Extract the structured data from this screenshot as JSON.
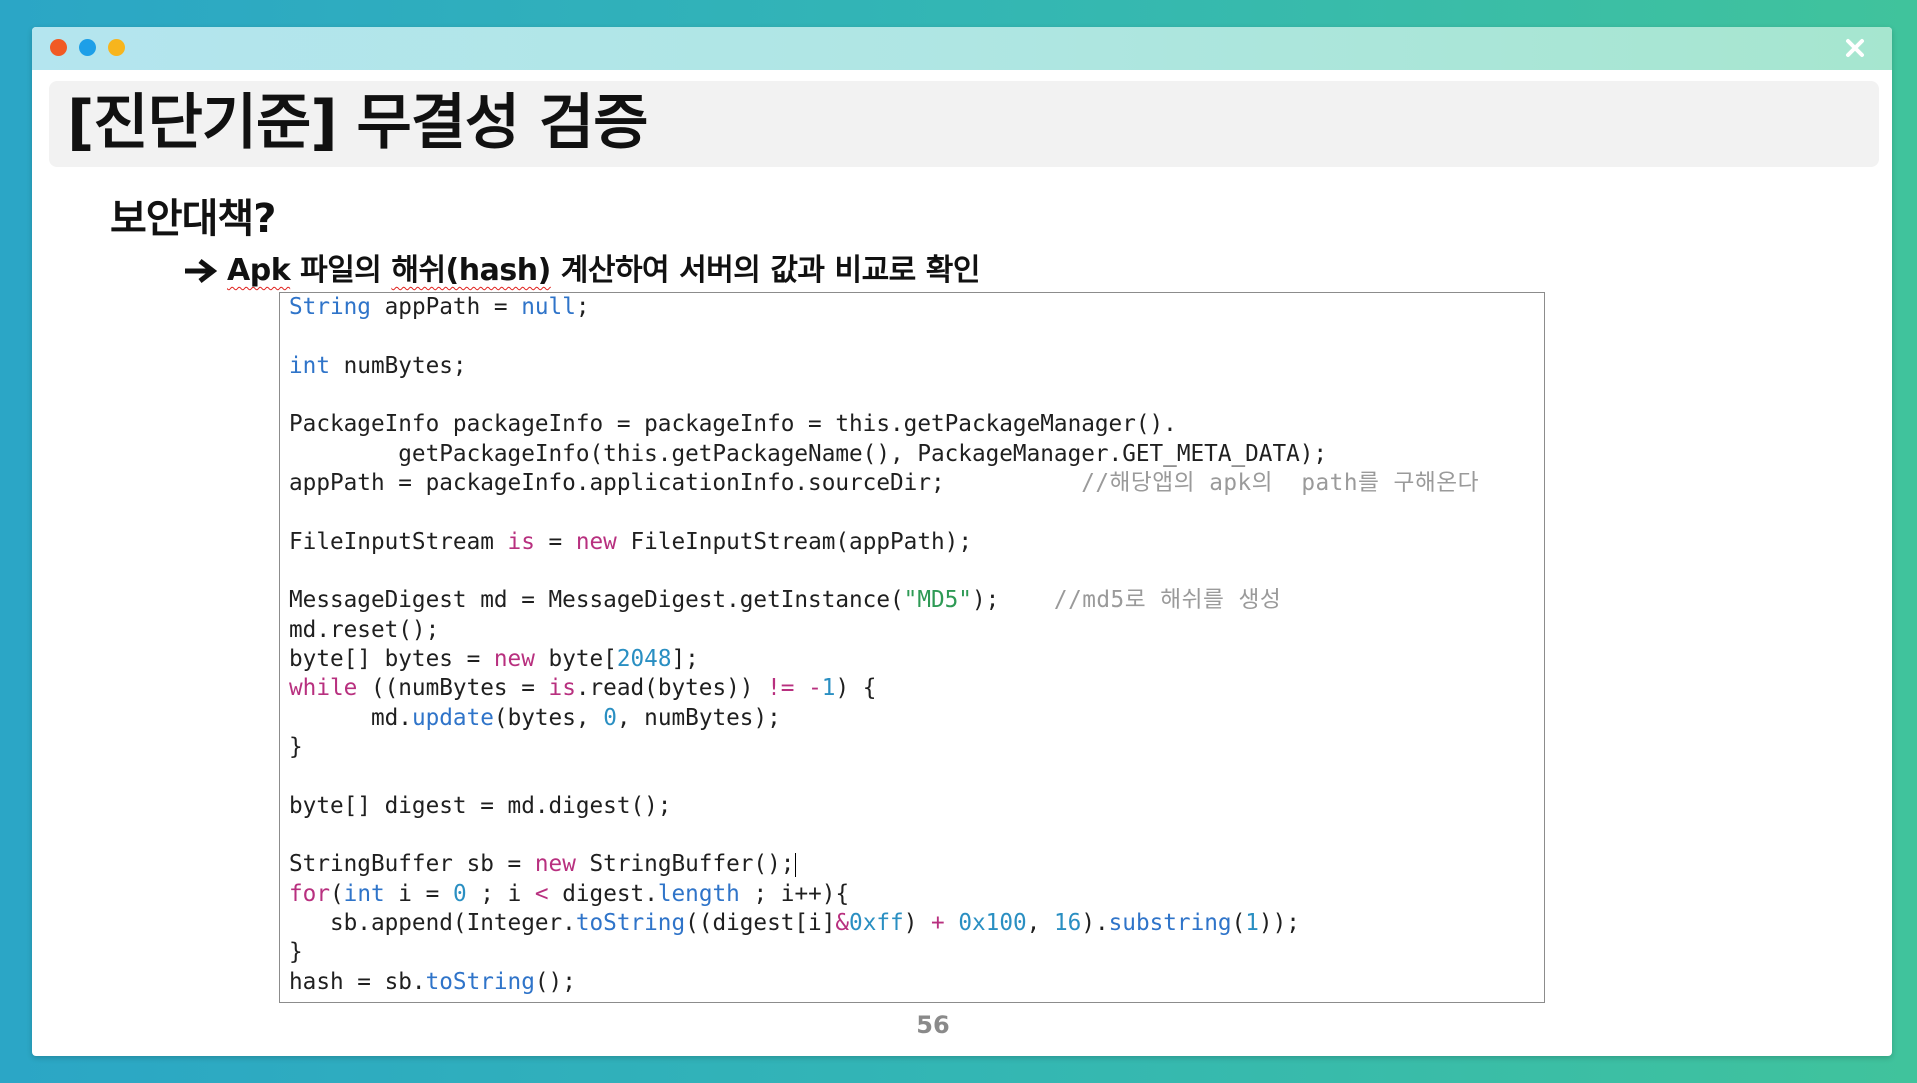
{
  "window": {
    "dot_colors": [
      "#f15a24",
      "#1d9fe8",
      "#f7b51d"
    ],
    "dot_icons": [
      "red-dot-icon",
      "blue-dot-icon",
      "yellow-dot-icon"
    ],
    "close_icon": "close-icon",
    "close_color": "#ffffff"
  },
  "slide": {
    "title": "[진단기준] 무결성 검증",
    "subtitle": "보안대책?",
    "point": {
      "icon": "right-arrow-icon",
      "segments": [
        "Apk",
        " 파일의 ",
        "해쉬(hash)",
        " 계산하여 서버의 값과 비교로 확인"
      ]
    },
    "page_number": "56"
  },
  "code": {
    "caret_line": 20,
    "colors": {
      "type": "#2f74c9",
      "kw": "#b8307f",
      "num": "#2a8fc2",
      "method": "#2f74c9",
      "str": "#2e9a55",
      "comment": "#9a9a9a"
    },
    "lines": [
      [
        [
          "String",
          "type"
        ],
        [
          " appPath = ",
          ""
        ],
        [
          "null",
          "type"
        ],
        [
          ";",
          ""
        ]
      ],
      [],
      [
        [
          "int",
          "type"
        ],
        [
          " numBytes;",
          ""
        ]
      ],
      [],
      [
        [
          "PackageInfo packageInfo = packageInfo = this.getPackageManager().",
          ""
        ]
      ],
      [
        [
          "        getPackageInfo(this.getPackageName(), PackageManager.GET_META_DATA);",
          ""
        ]
      ],
      [
        [
          "appPath = packageInfo.applicationInfo.sourceDir;          ",
          ""
        ],
        [
          "//해당앱의 apk의  path를 구해온다",
          "comment"
        ]
      ],
      [],
      [
        [
          "FileInputStream ",
          ""
        ],
        [
          "is",
          "kw"
        ],
        [
          " = ",
          ""
        ],
        [
          "new",
          "kw"
        ],
        [
          " FileInputStream(appPath);",
          ""
        ]
      ],
      [],
      [
        [
          "MessageDigest md = MessageDigest.getInstance(",
          ""
        ],
        [
          "\"MD5\"",
          "str"
        ],
        [
          ");    ",
          ""
        ],
        [
          "//md5로 해쉬를 생성",
          "comment"
        ]
      ],
      [
        [
          "md.reset();",
          ""
        ]
      ],
      [
        [
          "byte[] bytes = ",
          ""
        ],
        [
          "new",
          "kw"
        ],
        [
          " byte[",
          ""
        ],
        [
          "2048",
          "num"
        ],
        [
          "];",
          ""
        ]
      ],
      [
        [
          "while",
          "kw"
        ],
        [
          " ((numBytes = ",
          ""
        ],
        [
          "is",
          "kw"
        ],
        [
          ".read(bytes)) ",
          ""
        ],
        [
          "!=",
          "kw"
        ],
        [
          " ",
          ""
        ],
        [
          "-",
          "kw"
        ],
        [
          "1",
          "num"
        ],
        [
          ") {",
          ""
        ]
      ],
      [
        [
          "      md.",
          ""
        ],
        [
          "update",
          "method"
        ],
        [
          "(bytes, ",
          ""
        ],
        [
          "0",
          "num"
        ],
        [
          ", numBytes);",
          ""
        ]
      ],
      [
        [
          "}",
          ""
        ]
      ],
      [],
      [
        [
          "byte[] digest = md.digest();",
          ""
        ]
      ],
      [],
      [
        [
          "StringBuffer sb = ",
          ""
        ],
        [
          "new",
          "kw"
        ],
        [
          " StringBuffer();",
          ""
        ]
      ],
      [
        [
          "for",
          "kw"
        ],
        [
          "(",
          ""
        ],
        [
          "int",
          "type"
        ],
        [
          " i = ",
          ""
        ],
        [
          "0",
          "num"
        ],
        [
          " ; i ",
          ""
        ],
        [
          "<",
          "kw"
        ],
        [
          " digest.",
          ""
        ],
        [
          "length",
          "method"
        ],
        [
          " ; i++){",
          ""
        ]
      ],
      [
        [
          "   sb.append(Integer.",
          ""
        ],
        [
          "toString",
          "method"
        ],
        [
          "((digest[i]",
          ""
        ],
        [
          "&",
          "kw"
        ],
        [
          "0xff",
          "num"
        ],
        [
          ") ",
          ""
        ],
        [
          "+",
          "kw"
        ],
        [
          " ",
          ""
        ],
        [
          "0x100",
          "num"
        ],
        [
          ", ",
          ""
        ],
        [
          "16",
          "num"
        ],
        [
          ").",
          ""
        ],
        [
          "substring",
          "method"
        ],
        [
          "(",
          ""
        ],
        [
          "1",
          "num"
        ],
        [
          "));",
          ""
        ]
      ],
      [
        [
          "}",
          ""
        ]
      ],
      [
        [
          "hash = sb.",
          ""
        ],
        [
          "toString",
          "method"
        ],
        [
          "();",
          ""
        ]
      ]
    ]
  }
}
